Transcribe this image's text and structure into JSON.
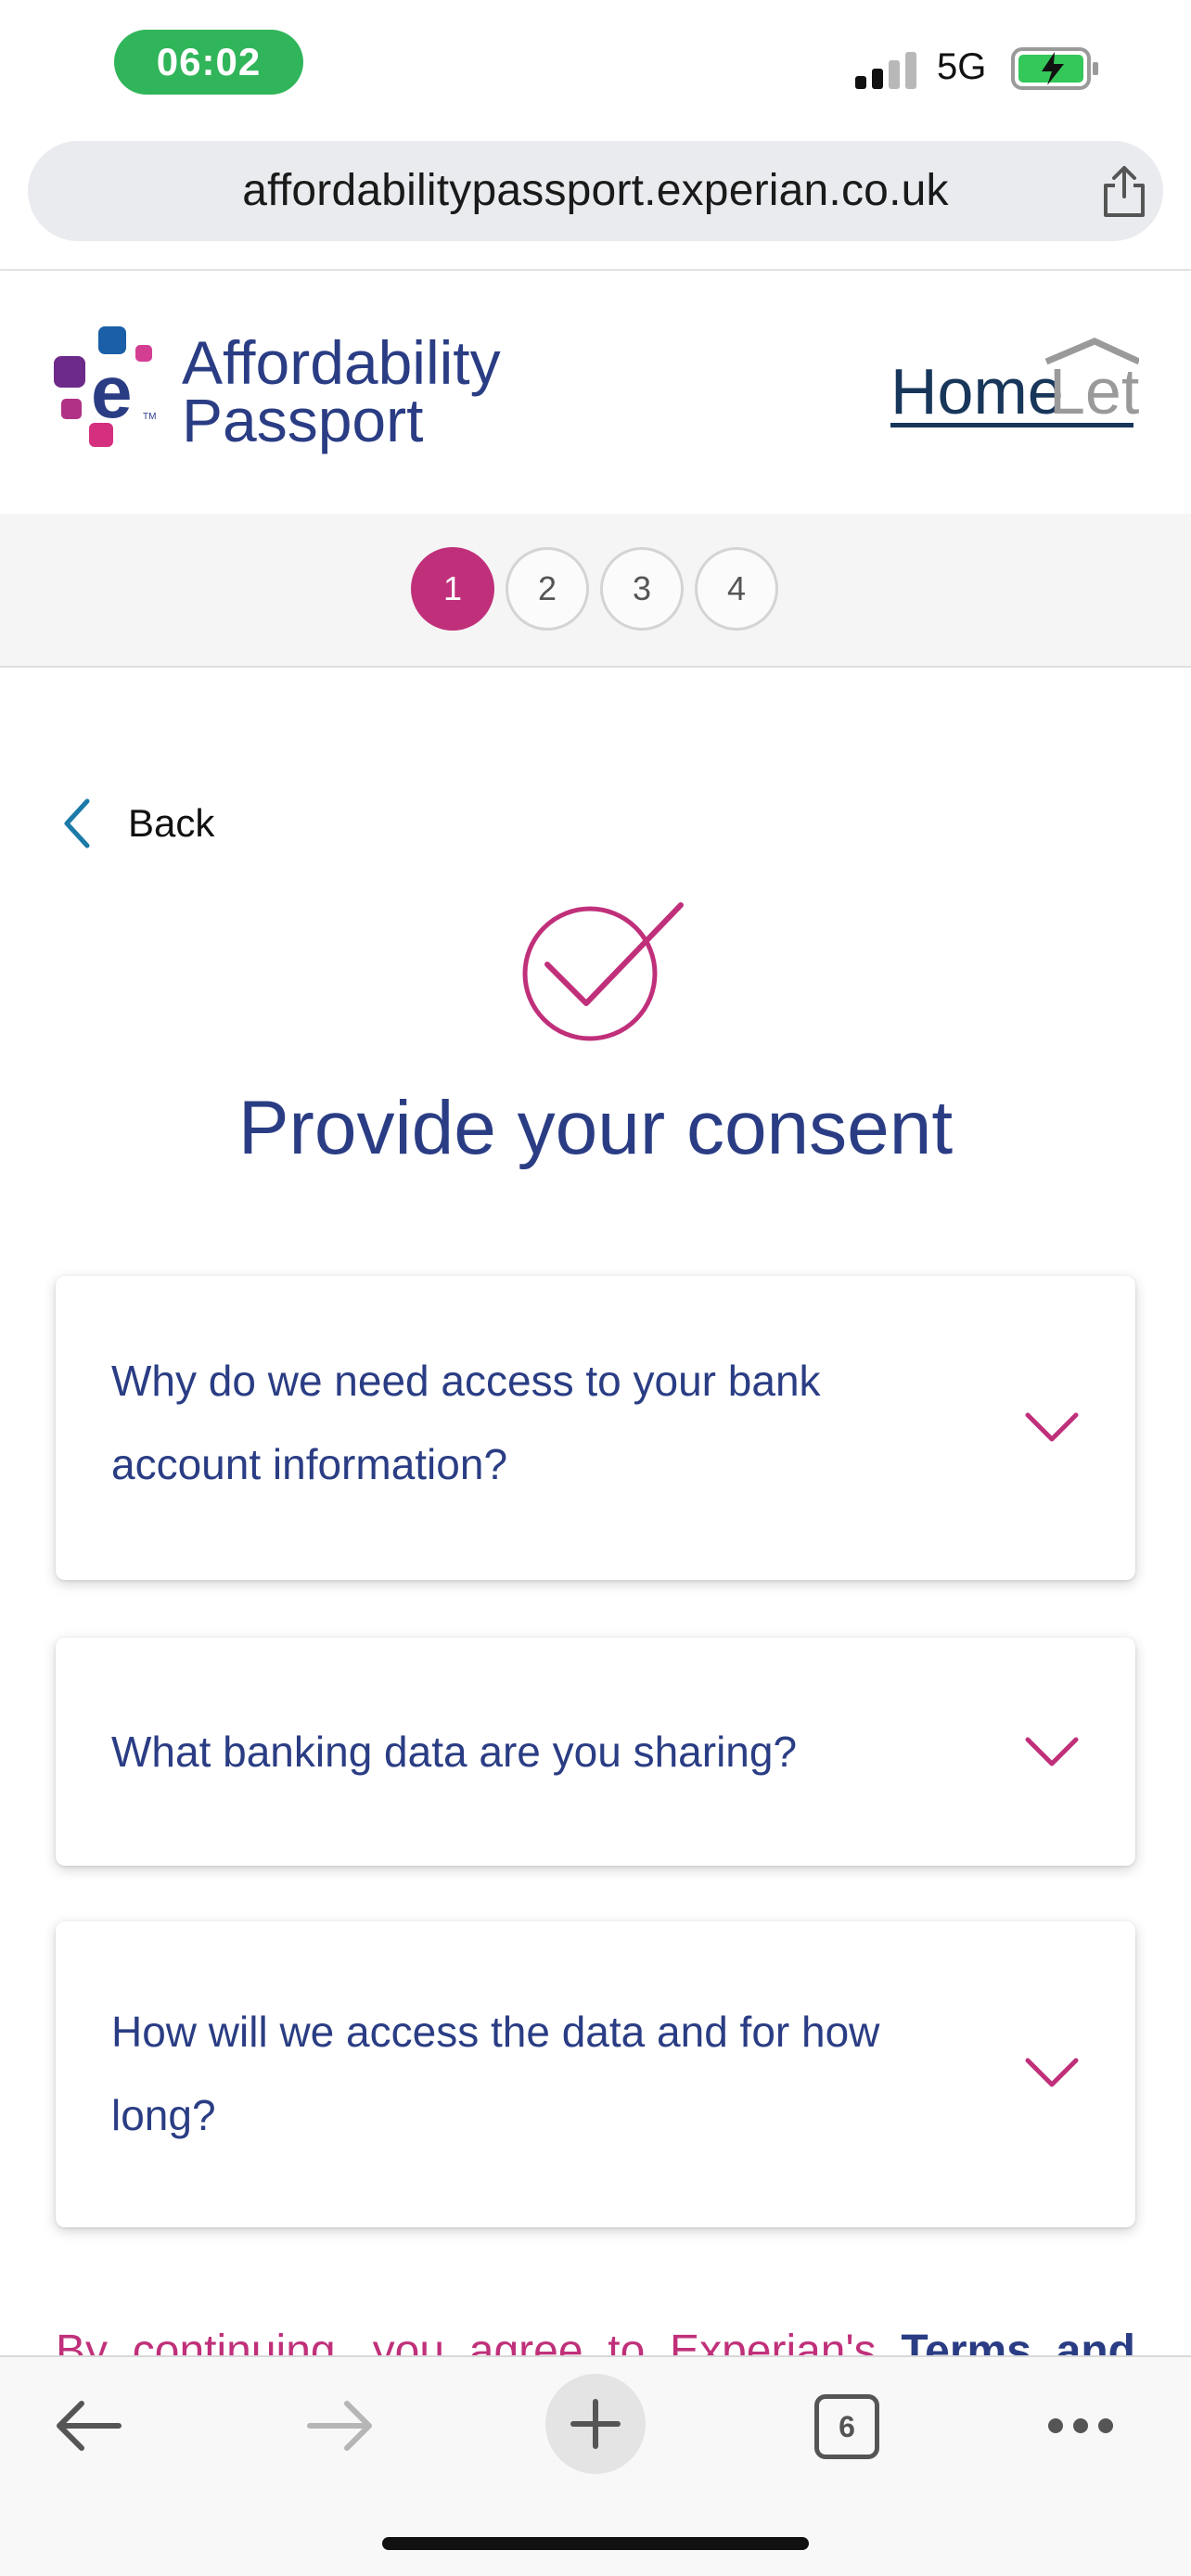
{
  "status_bar": {
    "time": "06:02",
    "network": "5G"
  },
  "browser": {
    "url": "affordabilitypassport.experian.co.uk",
    "tabs_count": "6"
  },
  "header": {
    "brand_line1": "Affordability",
    "brand_line2": "Passport",
    "partner_logo_text": "HomeLet"
  },
  "steps": [
    {
      "label": "1",
      "active": true
    },
    {
      "label": "2",
      "active": false
    },
    {
      "label": "3",
      "active": false
    },
    {
      "label": "4",
      "active": false
    }
  ],
  "main": {
    "back_label": "Back",
    "title": "Provide your consent",
    "faqs": [
      {
        "line1": "Why do we need access to your bank",
        "line2": "account information?"
      },
      {
        "line1": "What banking data are you sharing?",
        "line2": ""
      },
      {
        "line1": "How will we access the data and for how",
        "line2": "long?"
      }
    ],
    "consent": {
      "w1": "By",
      "w2": "continuing,",
      "w3": "you",
      "w4": "agree",
      "w5": "to",
      "w6": "Experian's",
      "w7": "Terms",
      "w8": "and"
    }
  },
  "colors": {
    "brand_blue": "#2a3d84",
    "accent_magenta": "#c0307a",
    "status_green": "#30b55a"
  }
}
